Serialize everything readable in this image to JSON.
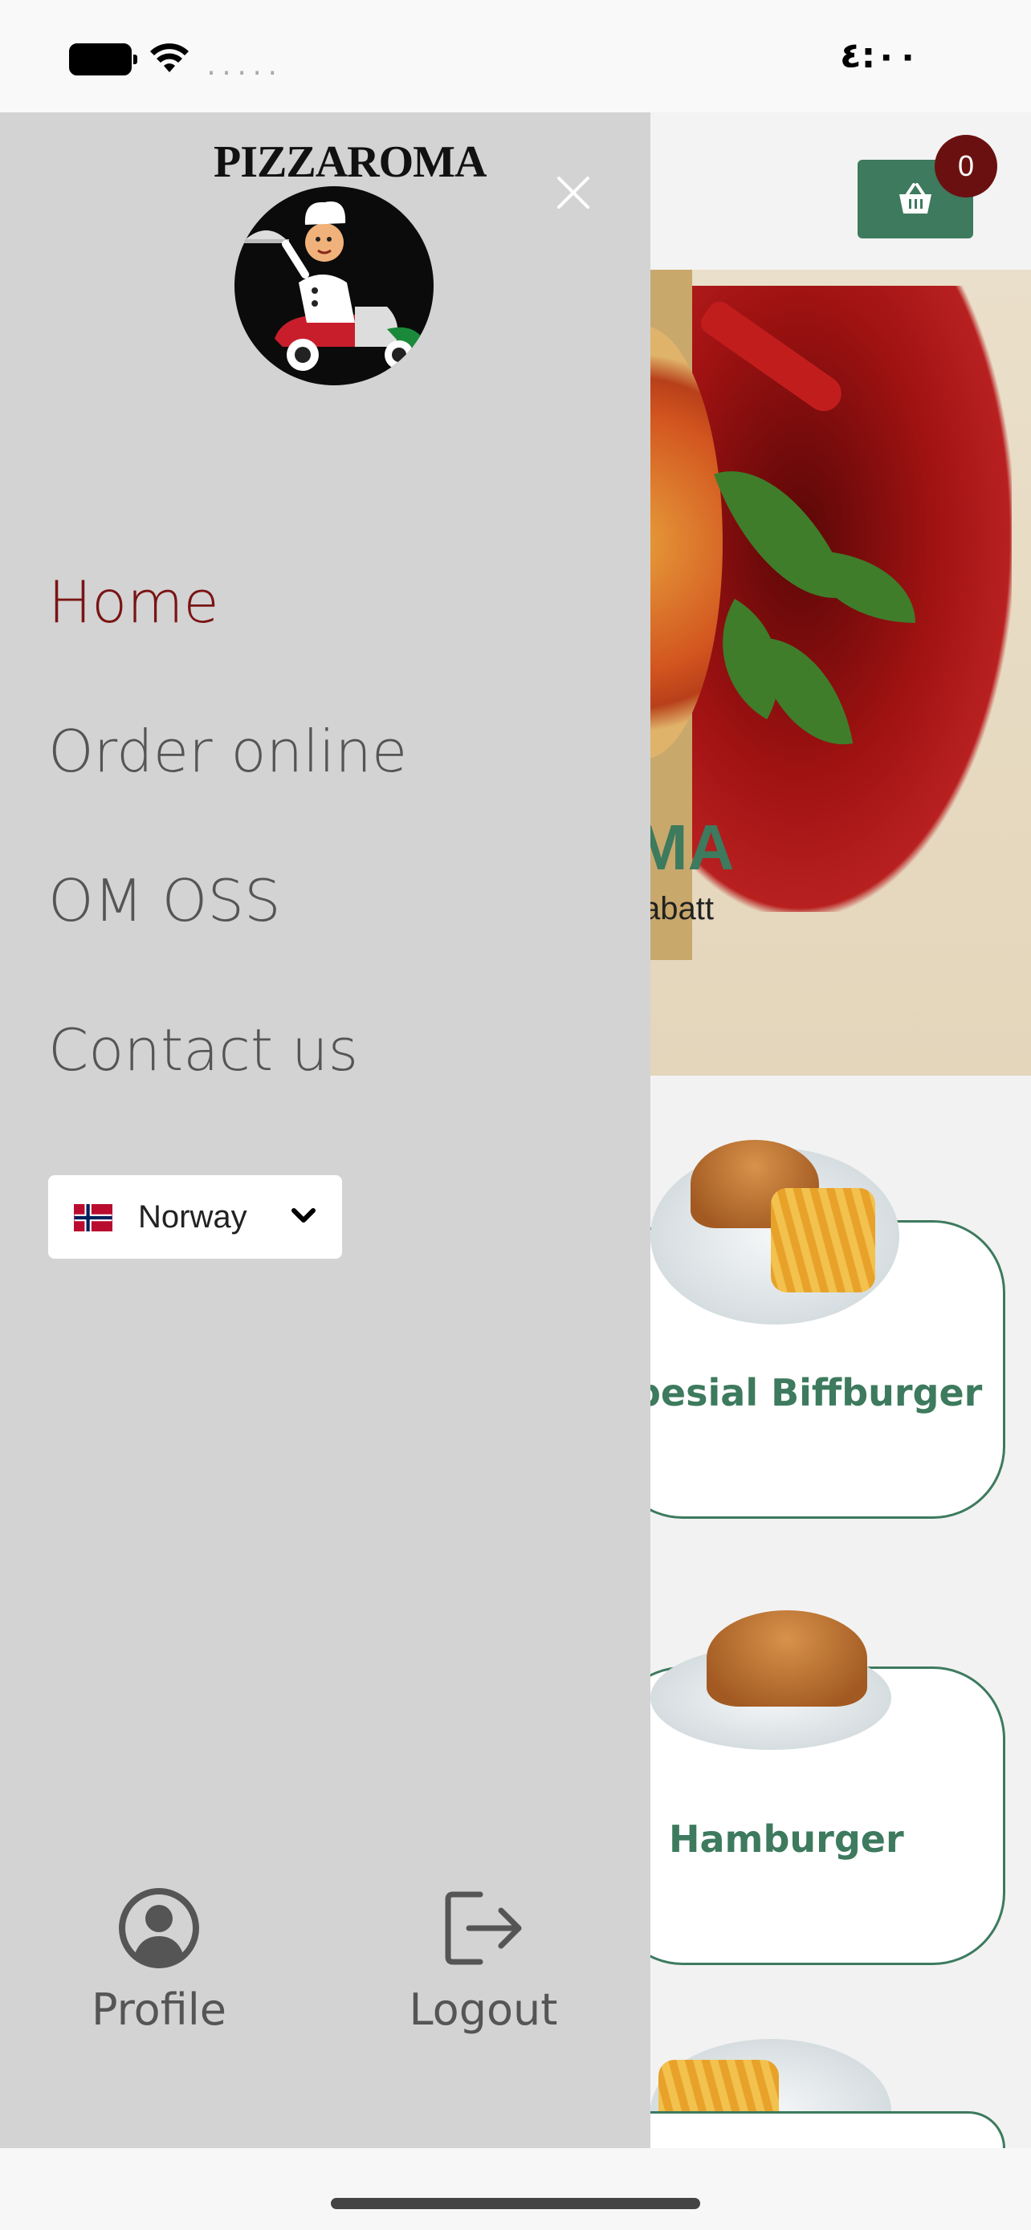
{
  "status_bar": {
    "time": "٤:٠٠",
    "signal": "....."
  },
  "header": {
    "cart_count": "0"
  },
  "hero": {
    "title_fragment": "MA",
    "subtitle_fragment": "abatt"
  },
  "products": [
    {
      "name": "pesial Biffburger"
    },
    {
      "name": "Hamburger"
    }
  ],
  "drawer": {
    "logo_text": "PIZZAROMA",
    "nav": [
      {
        "label": "Home",
        "active": true
      },
      {
        "label": "Order online",
        "active": false
      },
      {
        "label": "OM OSS",
        "active": false
      },
      {
        "label": "Contact us",
        "active": false
      }
    ],
    "country_select": {
      "value": "Norway"
    },
    "footer": {
      "profile_label": "Profile",
      "logout_label": "Logout"
    }
  },
  "colors": {
    "accent_green": "#3d7a5e",
    "active_nav": "#7a1414",
    "drawer_bg": "#d3d3d3",
    "badge": "#6b1010"
  },
  "icons": [
    "battery-icon",
    "wifi-icon",
    "basket-icon",
    "close-icon",
    "norway-flag-icon",
    "chevron-down-icon",
    "user-circle-icon",
    "logout-icon"
  ]
}
